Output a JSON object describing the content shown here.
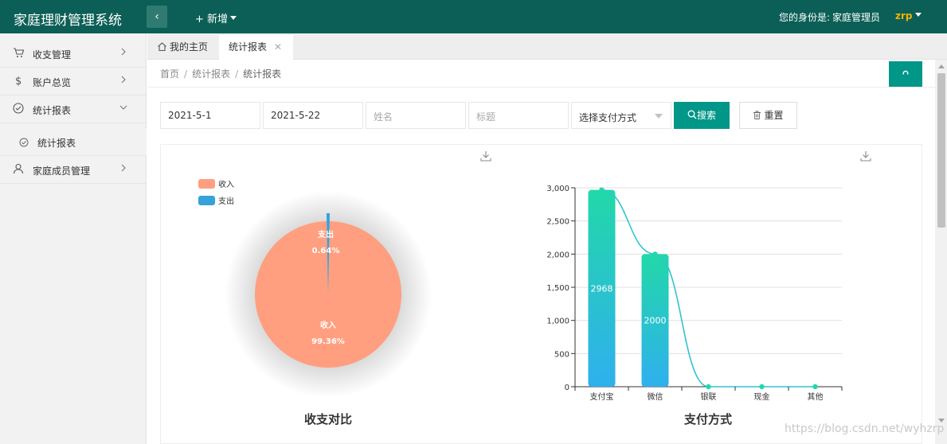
{
  "app": {
    "title": "家庭理财管理系统",
    "add_label": "+ 新增"
  },
  "user": {
    "identity_label": "您的身份是:",
    "role": "家庭管理员",
    "name": "zrp"
  },
  "sidebar": {
    "items": [
      {
        "label": "收支管理",
        "icon": "cart-icon"
      },
      {
        "label": "账户总览",
        "icon": "dollar-icon"
      },
      {
        "label": "统计报表",
        "icon": "check-circle-icon"
      },
      {
        "label": "家庭成员管理",
        "icon": "users-icon"
      }
    ],
    "sub_items": [
      {
        "label": "统计报表",
        "icon": "check-circle-icon"
      }
    ]
  },
  "tabs": {
    "home": "我的主页",
    "active": "统计报表"
  },
  "breadcrumb": {
    "home": "首页",
    "parent": "统计报表",
    "current": "统计报表",
    "separator": "/"
  },
  "filters": {
    "start_date": "2021-5-1",
    "end_date": "2021-5-22",
    "name_placeholder": "姓名",
    "title_placeholder": "标题",
    "payment_select": "选择支付方式",
    "search_label": "搜索",
    "reset_label": "重置"
  },
  "colors": {
    "topbar": "#0c5f56",
    "accent": "#009688",
    "income": "#ff9f7f",
    "expense": "#37a2da",
    "bar_top": "#22d8a8",
    "bar_bottom": "#2fb0ee",
    "line": "#2fc4d0"
  },
  "watermark": "https://blog.csdn.net/wyhzrp",
  "chart_data": [
    {
      "type": "pie",
      "title": "收支对比",
      "legend": [
        "收入",
        "支出"
      ],
      "legend_placement": "top-left",
      "slices": [
        {
          "name": "收入",
          "percent": 99.36,
          "label": "99.36%"
        },
        {
          "name": "支出",
          "percent": 0.64,
          "label": "0.64%"
        }
      ]
    },
    {
      "type": "bar",
      "title": "支付方式",
      "categories": [
        "支付宝",
        "微信",
        "银联",
        "现金",
        "其他"
      ],
      "values": [
        2968,
        2000,
        0,
        0,
        0
      ],
      "ylim": [
        0,
        3000
      ],
      "yticks": [
        "0",
        "500",
        "1,000",
        "1,500",
        "2,000",
        "2,500",
        "3,000"
      ],
      "grid": true,
      "overlay_line": true
    }
  ]
}
